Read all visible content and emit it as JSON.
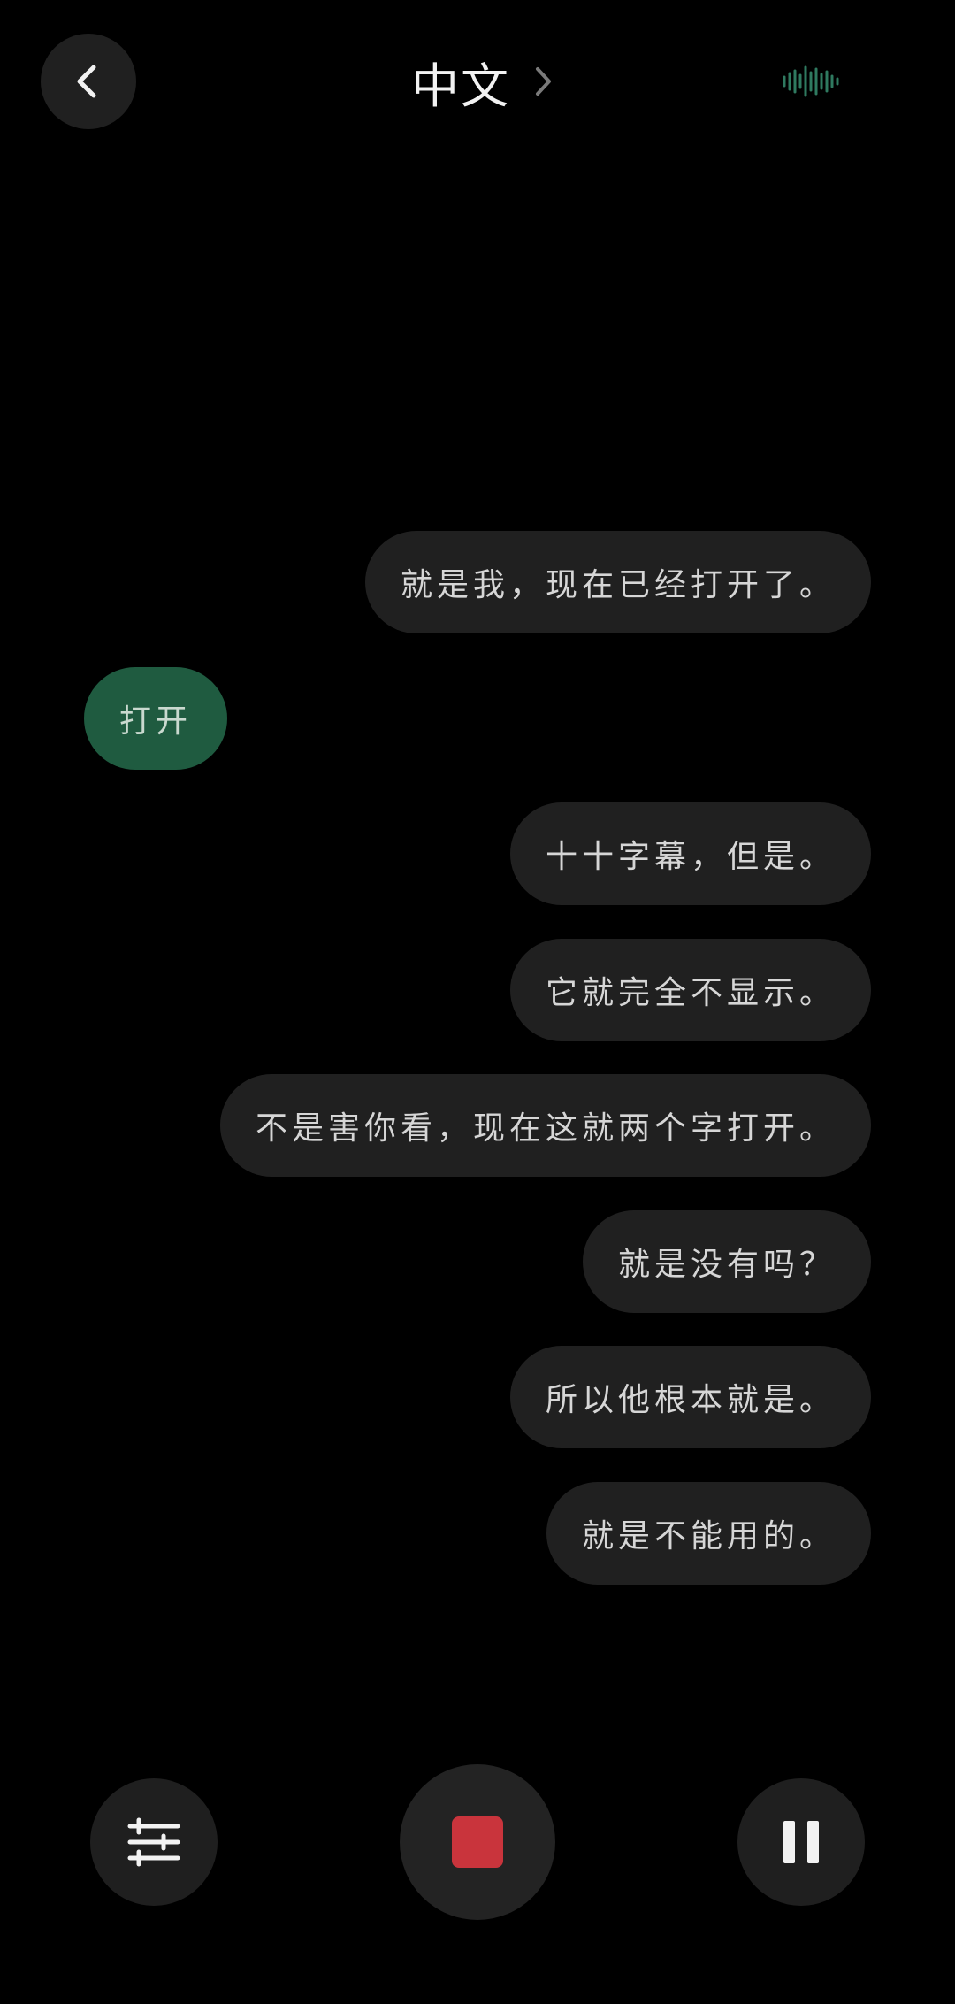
{
  "header": {
    "title": "中文",
    "back_icon": "chevron-left-icon",
    "title_icon": "chevron-right-icon",
    "status_icon": "audio-waveform-icon"
  },
  "messages": [
    {
      "side": "right",
      "text": "就是我，现在已经打开了。"
    },
    {
      "side": "left",
      "text": "打开"
    },
    {
      "side": "right",
      "text": "十十字幕，但是。"
    },
    {
      "side": "right",
      "text": "它就完全不显示。"
    },
    {
      "side": "right",
      "text": "不是害你看，现在这就两个字打开。"
    },
    {
      "side": "right",
      "text": "就是没有吗？"
    },
    {
      "side": "right",
      "text": "所以他根本就是。"
    },
    {
      "side": "right",
      "text": "就是不能用的。"
    }
  ],
  "controls": {
    "settings_icon": "sliders-icon",
    "stop_icon": "stop-icon",
    "pause_icon": "pause-icon"
  },
  "colors": {
    "background": "#000000",
    "bubble": "#202020",
    "bubble_left": "#1f5b40",
    "stop_accent": "#c9343c",
    "wave_accent": "#2f7a60"
  }
}
